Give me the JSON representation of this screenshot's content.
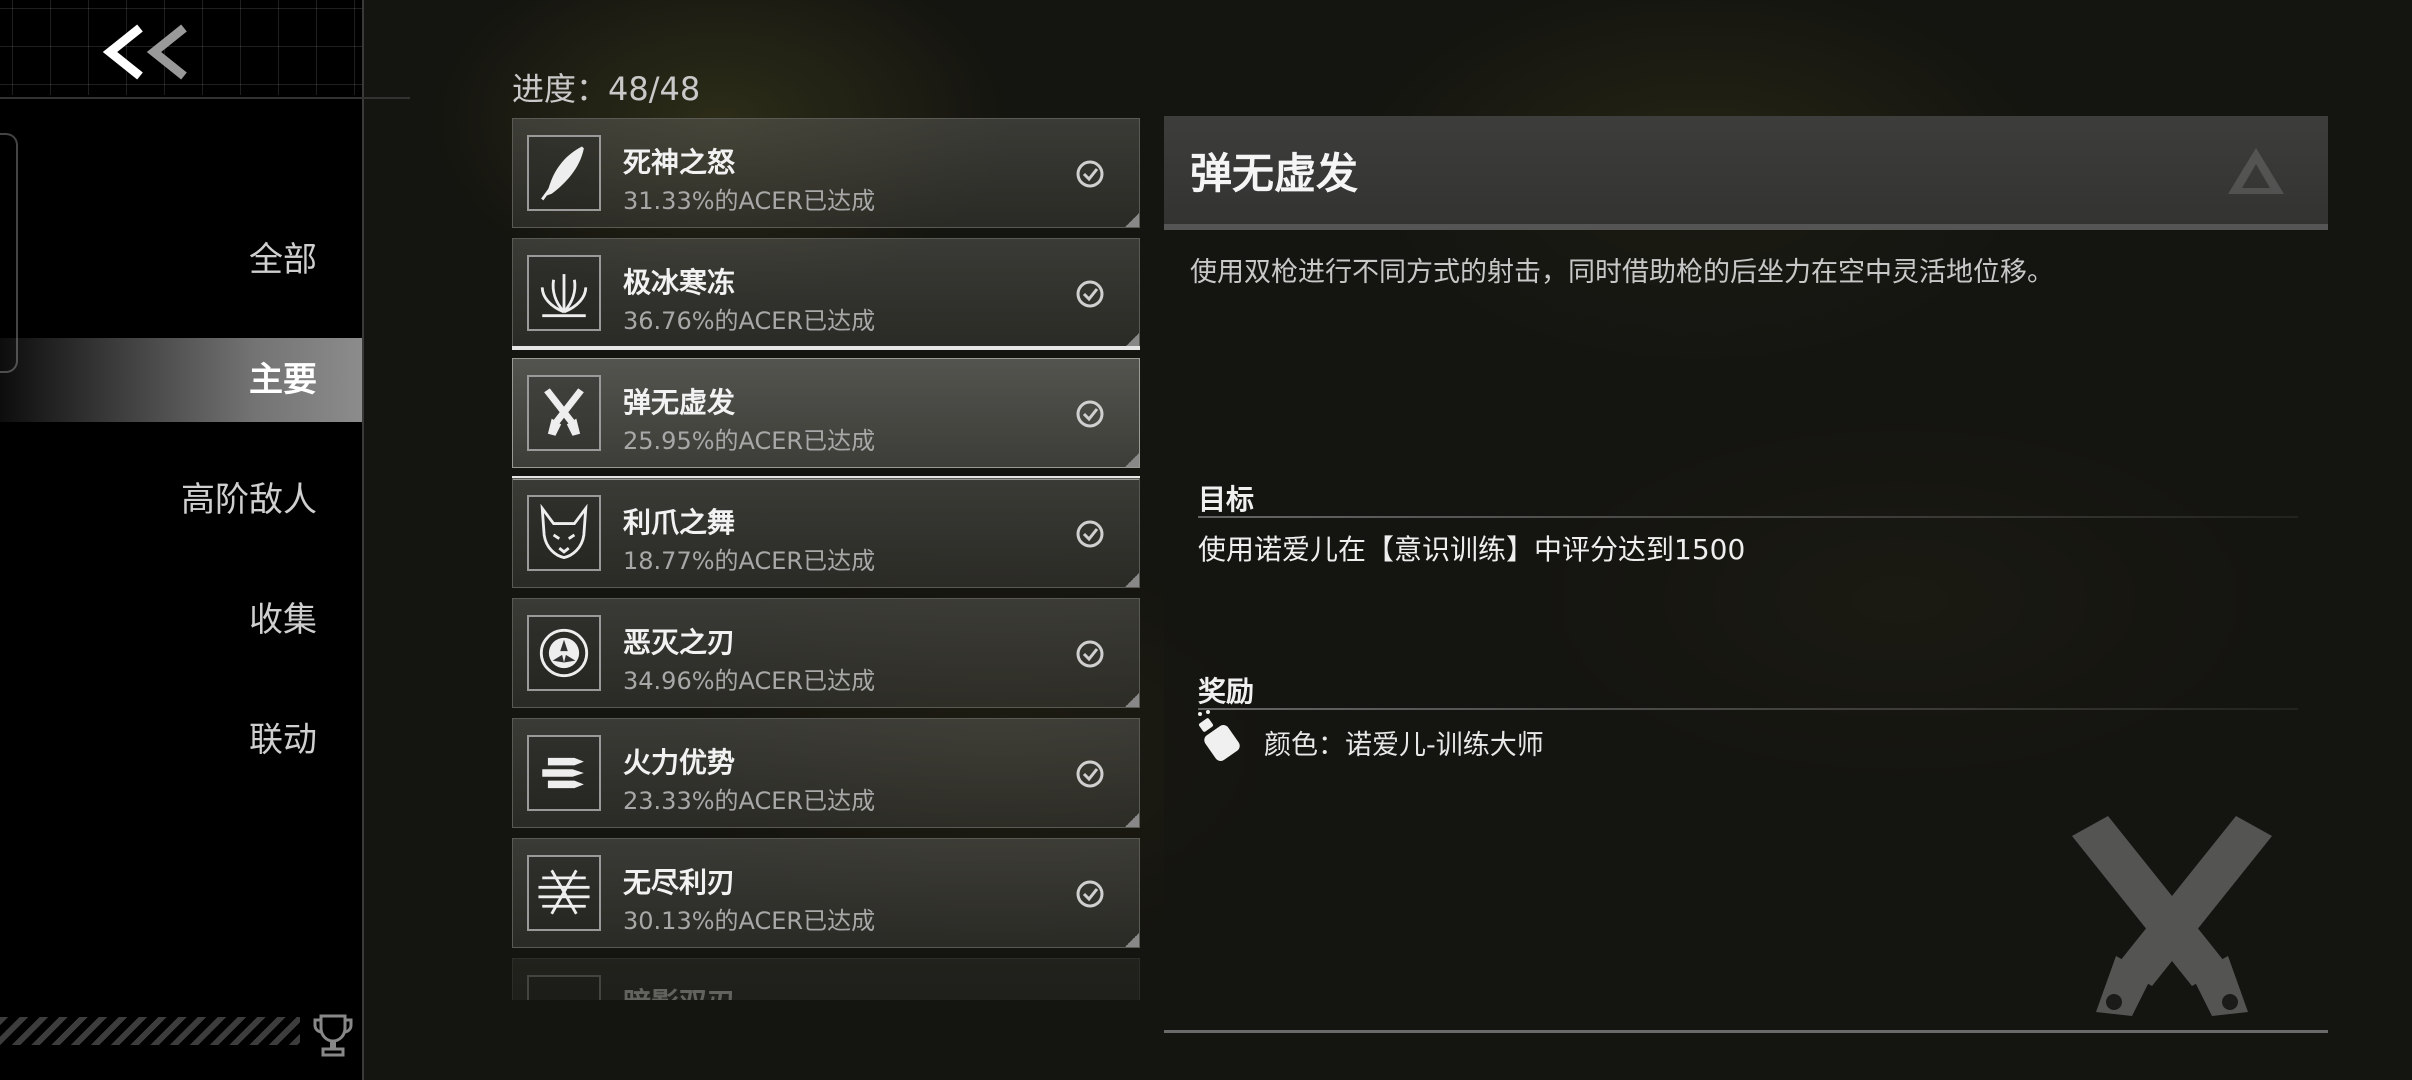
{
  "nav": {
    "back_label": "<<",
    "items": [
      {
        "label": "全部"
      },
      {
        "label": "主要"
      },
      {
        "label": "高阶敌人"
      },
      {
        "label": "收集"
      },
      {
        "label": "联动"
      }
    ],
    "active_index": 1
  },
  "progress": {
    "text": "进度：48/48"
  },
  "achievements": [
    {
      "title": "死神之怒",
      "subtitle": "31.33%的ACER已达成",
      "icon": "feather-icon",
      "completed": true
    },
    {
      "title": "极冰寒冻",
      "subtitle": "36.76%的ACER已达成",
      "icon": "ice-crystal-icon",
      "completed": true
    },
    {
      "title": "弹无虚发",
      "subtitle": "25.95%的ACER已达成",
      "icon": "crossed-pistols-icon",
      "completed": true,
      "selected": true
    },
    {
      "title": "利爪之舞",
      "subtitle": "18.77%的ACER已达成",
      "icon": "fox-mask-icon",
      "completed": true
    },
    {
      "title": "恶灭之刃",
      "subtitle": "34.96%的ACER已达成",
      "icon": "triskelion-icon",
      "completed": true
    },
    {
      "title": "火力优势",
      "subtitle": "23.33%的ACER已达成",
      "icon": "bullets-icon",
      "completed": true
    },
    {
      "title": "无尽利刃",
      "subtitle": "30.13%的ACER已达成",
      "icon": "blades-icon",
      "completed": true
    },
    {
      "title": "暗影双刃",
      "subtitle": "",
      "icon": "blank-icon",
      "completed": false
    }
  ],
  "detail": {
    "title": "弹无虚发",
    "description": "使用双枪进行不同方式的射击，同时借助枪的后坐力在空中灵活地位移。",
    "goal_label": "目标",
    "goal_text": "使用诺爱儿在【意识训练】中评分达到1500",
    "reward_label": "奖励",
    "reward_text": "颜色：诺爱儿-训练大师"
  },
  "colors": {
    "accent": "#e6e6e6",
    "row_bg": "#55554f",
    "sidebar_bg": "#000000"
  }
}
